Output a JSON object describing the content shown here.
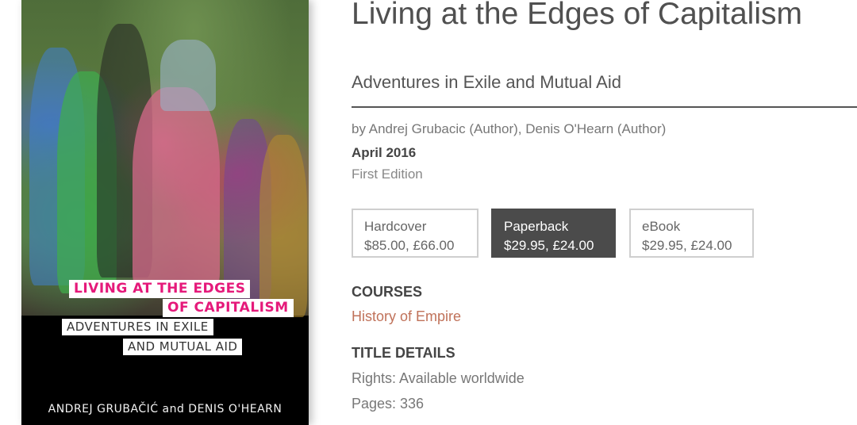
{
  "cover": {
    "title_line1": "LIVING AT THE EDGES",
    "title_line2": "OF CAPITALISM",
    "subtitle_line1": "ADVENTURES IN EXILE",
    "subtitle_line2": "AND MUTUAL AID",
    "authors": "ANDREJ GRUBAČIĆ and DENIS O'HEARN"
  },
  "book": {
    "title": "Living at the Edges of Capitalism",
    "subtitle": "Adventures in Exile and Mutual Aid",
    "byline": "by Andrej Grubacic (Author), Denis O'Hearn (Author)",
    "date": "April 2016",
    "edition": "First Edition"
  },
  "formats": [
    {
      "name": "Hardcover",
      "price": "$85.00,  £66.00",
      "active": false
    },
    {
      "name": "Paperback",
      "price": "$29.95,  £24.00",
      "active": true
    },
    {
      "name": "eBook",
      "price": "$29.95,  £24.00",
      "active": false
    }
  ],
  "courses": {
    "heading": "COURSES",
    "items": [
      "History of Empire"
    ]
  },
  "title_details": {
    "heading": "TITLE DETAILS",
    "rights": "Rights: Available worldwide",
    "pages": "Pages: 336"
  },
  "colors": {
    "accent_link": "#c0725a",
    "active_format_bg": "#4b4b4b",
    "cover_title_pink": "#e5197a"
  }
}
